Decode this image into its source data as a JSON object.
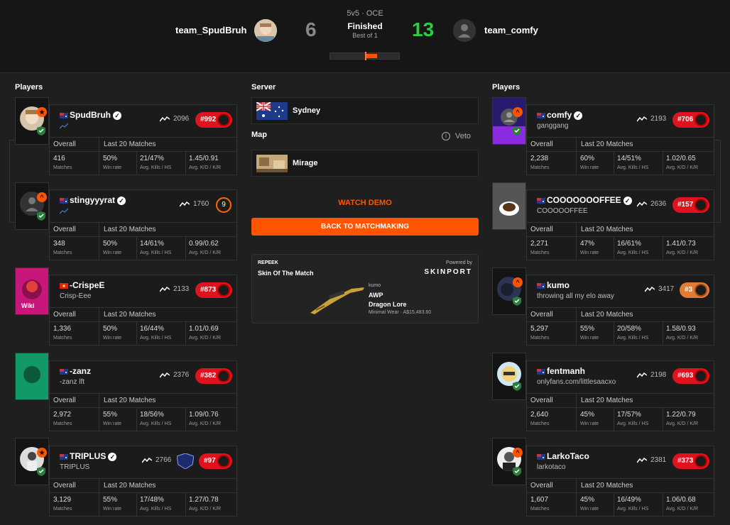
{
  "match": {
    "team1": {
      "name": "team_SpudBruh",
      "score": "6"
    },
    "team2": {
      "name": "team_comfy",
      "score": "13"
    },
    "mode": "5v5 · OCE",
    "status": "Finished",
    "best_of": "Best of 1"
  },
  "players_title": "Players",
  "server": {
    "label": "Server",
    "value": "Sydney"
  },
  "map": {
    "label": "Map",
    "value": "Mirage",
    "veto": "Veto"
  },
  "actions": {
    "watch_demo": "WATCH DEMO",
    "back": "BACK TO MATCHMAKING"
  },
  "skin": {
    "brand": "REPEEK",
    "title": "Skin Of The Match",
    "powered_by": "Powered by",
    "sponsor": "SKINPORT",
    "owner": "kumo",
    "weapon": "AWP",
    "skin_name": "Dragon Lore",
    "wear_price": "Minimal Wear · A$15,483.60"
  },
  "stats_headers": {
    "overall": "Overall",
    "last20": "Last 20 Matches"
  },
  "stat_labels": {
    "matches": "Matches",
    "winrate": "Win rate",
    "kills_hs": "Avg. Kills / HS",
    "kd_kr": "Avg. K/D / K/R"
  },
  "team1_players": [
    {
      "name": "SpudBruh",
      "sub": "",
      "elo": "2096",
      "rank": "#992",
      "matches": "416",
      "winrate": "50%",
      "kills_hs": "21/47%",
      "kd_kr": "1.45/0.91",
      "verified": true
    },
    {
      "name": "stingyyyrat",
      "sub": "",
      "elo": "1760",
      "level": "9",
      "matches": "348",
      "winrate": "50%",
      "kills_hs": "14/61%",
      "kd_kr": "0.99/0.62",
      "verified": true
    },
    {
      "name": "-CrispeE",
      "sub": "Crisp-Eee",
      "elo": "2133",
      "rank": "#873",
      "matches": "1,336",
      "winrate": "50%",
      "kills_hs": "16/44%",
      "kd_kr": "1.01/0.69",
      "verified": false
    },
    {
      "name": "-zanz",
      "sub": "-zanz lft",
      "elo": "2376",
      "rank": "#382",
      "matches": "2,972",
      "winrate": "55%",
      "kills_hs": "18/56%",
      "kd_kr": "1.09/0.76",
      "verified": false
    },
    {
      "name": "TRIPLUS",
      "sub": "TRIPLUS",
      "elo": "2766",
      "rank": "#97",
      "matches": "3,129",
      "winrate": "55%",
      "kills_hs": "17/48%",
      "kd_kr": "1.27/0.78",
      "verified": true
    }
  ],
  "team2_players": [
    {
      "name": "comfy",
      "sub": "ganggang",
      "elo": "2193",
      "rank": "#706",
      "matches": "2,238",
      "winrate": "60%",
      "kills_hs": "14/51%",
      "kd_kr": "1.02/0.65",
      "verified": true
    },
    {
      "name": "COOOOOOOFFEE",
      "sub": "COOOOOFFEE",
      "elo": "2636",
      "rank": "#157",
      "matches": "2,271",
      "winrate": "47%",
      "kills_hs": "16/61%",
      "kd_kr": "1.41/0.73",
      "verified": true
    },
    {
      "name": "kumo",
      "sub": "throwing all my elo away",
      "elo": "3417",
      "rank": "#3",
      "matches": "5,297",
      "winrate": "55%",
      "kills_hs": "20/58%",
      "kd_kr": "1.58/0.93",
      "verified": false
    },
    {
      "name": "fentmanh",
      "sub": "onlyfans.com/littlesaacxo",
      "elo": "2198",
      "rank": "#693",
      "matches": "2,640",
      "winrate": "45%",
      "kills_hs": "17/57%",
      "kd_kr": "1.22/0.79",
      "verified": false
    },
    {
      "name": "LarkoTaco",
      "sub": "larkotaco",
      "elo": "2381",
      "rank": "#373",
      "matches": "1,607",
      "winrate": "45%",
      "kills_hs": "16/49%",
      "kd_kr": "1.06/0.68",
      "verified": false
    }
  ],
  "colors": {
    "accent": "#ff5500",
    "win": "#2ecc40",
    "loss": "#888888",
    "rank_red": "#e0121e"
  }
}
